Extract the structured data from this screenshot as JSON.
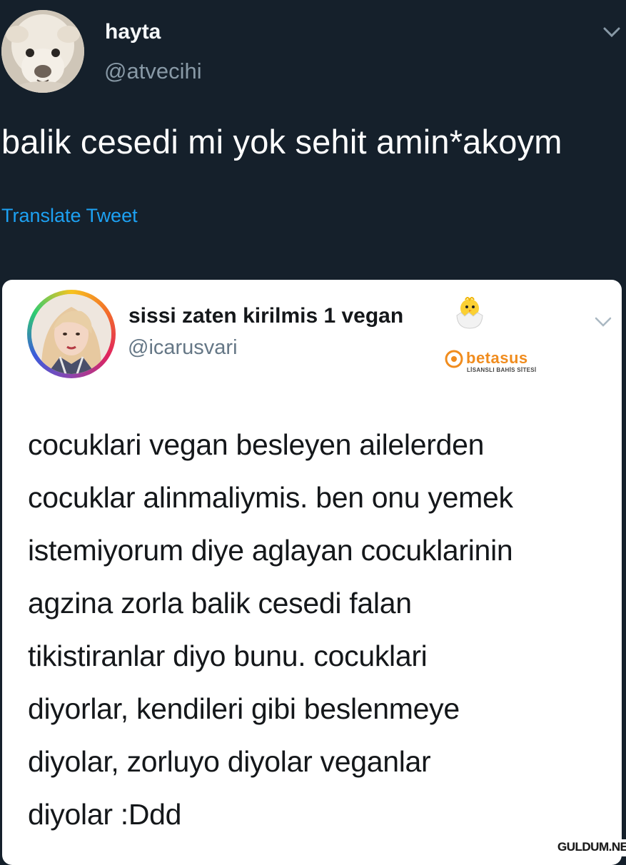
{
  "tweet": {
    "author_name": "hayta",
    "author_handle": "@atvecihi",
    "text": "balik cesedi mi yok sehit amin*akoym",
    "translate_label": "Translate Tweet",
    "menu_icon": "chevron-down-icon",
    "avatar_icon": "alpaca-avatar"
  },
  "quoted_tweet": {
    "author_name": "sissi zaten kirilmis 1 vegan",
    "name_emoji": "hatching-chick-icon",
    "author_handle": "@icarusvari",
    "menu_icon": "chevron-down-icon",
    "avatar_icon": "woman-avatar",
    "lines": [
      "cocuklari vegan besleyen ailelerden",
      "cocuklar alinmaliymis. ben onu yemek",
      "istemiyorum diye aglayan cocuklarinin",
      "agzina zorla balik cesedi falan",
      "tikistiranlar diyo bunu. cocuklari",
      "diyorlar, kendileri gibi beslenmeye",
      "diyolar, zorluyo diyolar veganlar",
      "diyolar :Ddd"
    ]
  },
  "watermark": {
    "brand": "betasus",
    "tagline": "LİSANSLI BAHİS SİTESİ"
  },
  "corner_badge": "GULDUM.NET",
  "colors": {
    "dark_bg": "#15202b",
    "link_blue": "#1da1f2",
    "handle_gray": "#8899a6",
    "brand_orange": "#f08c1e"
  }
}
